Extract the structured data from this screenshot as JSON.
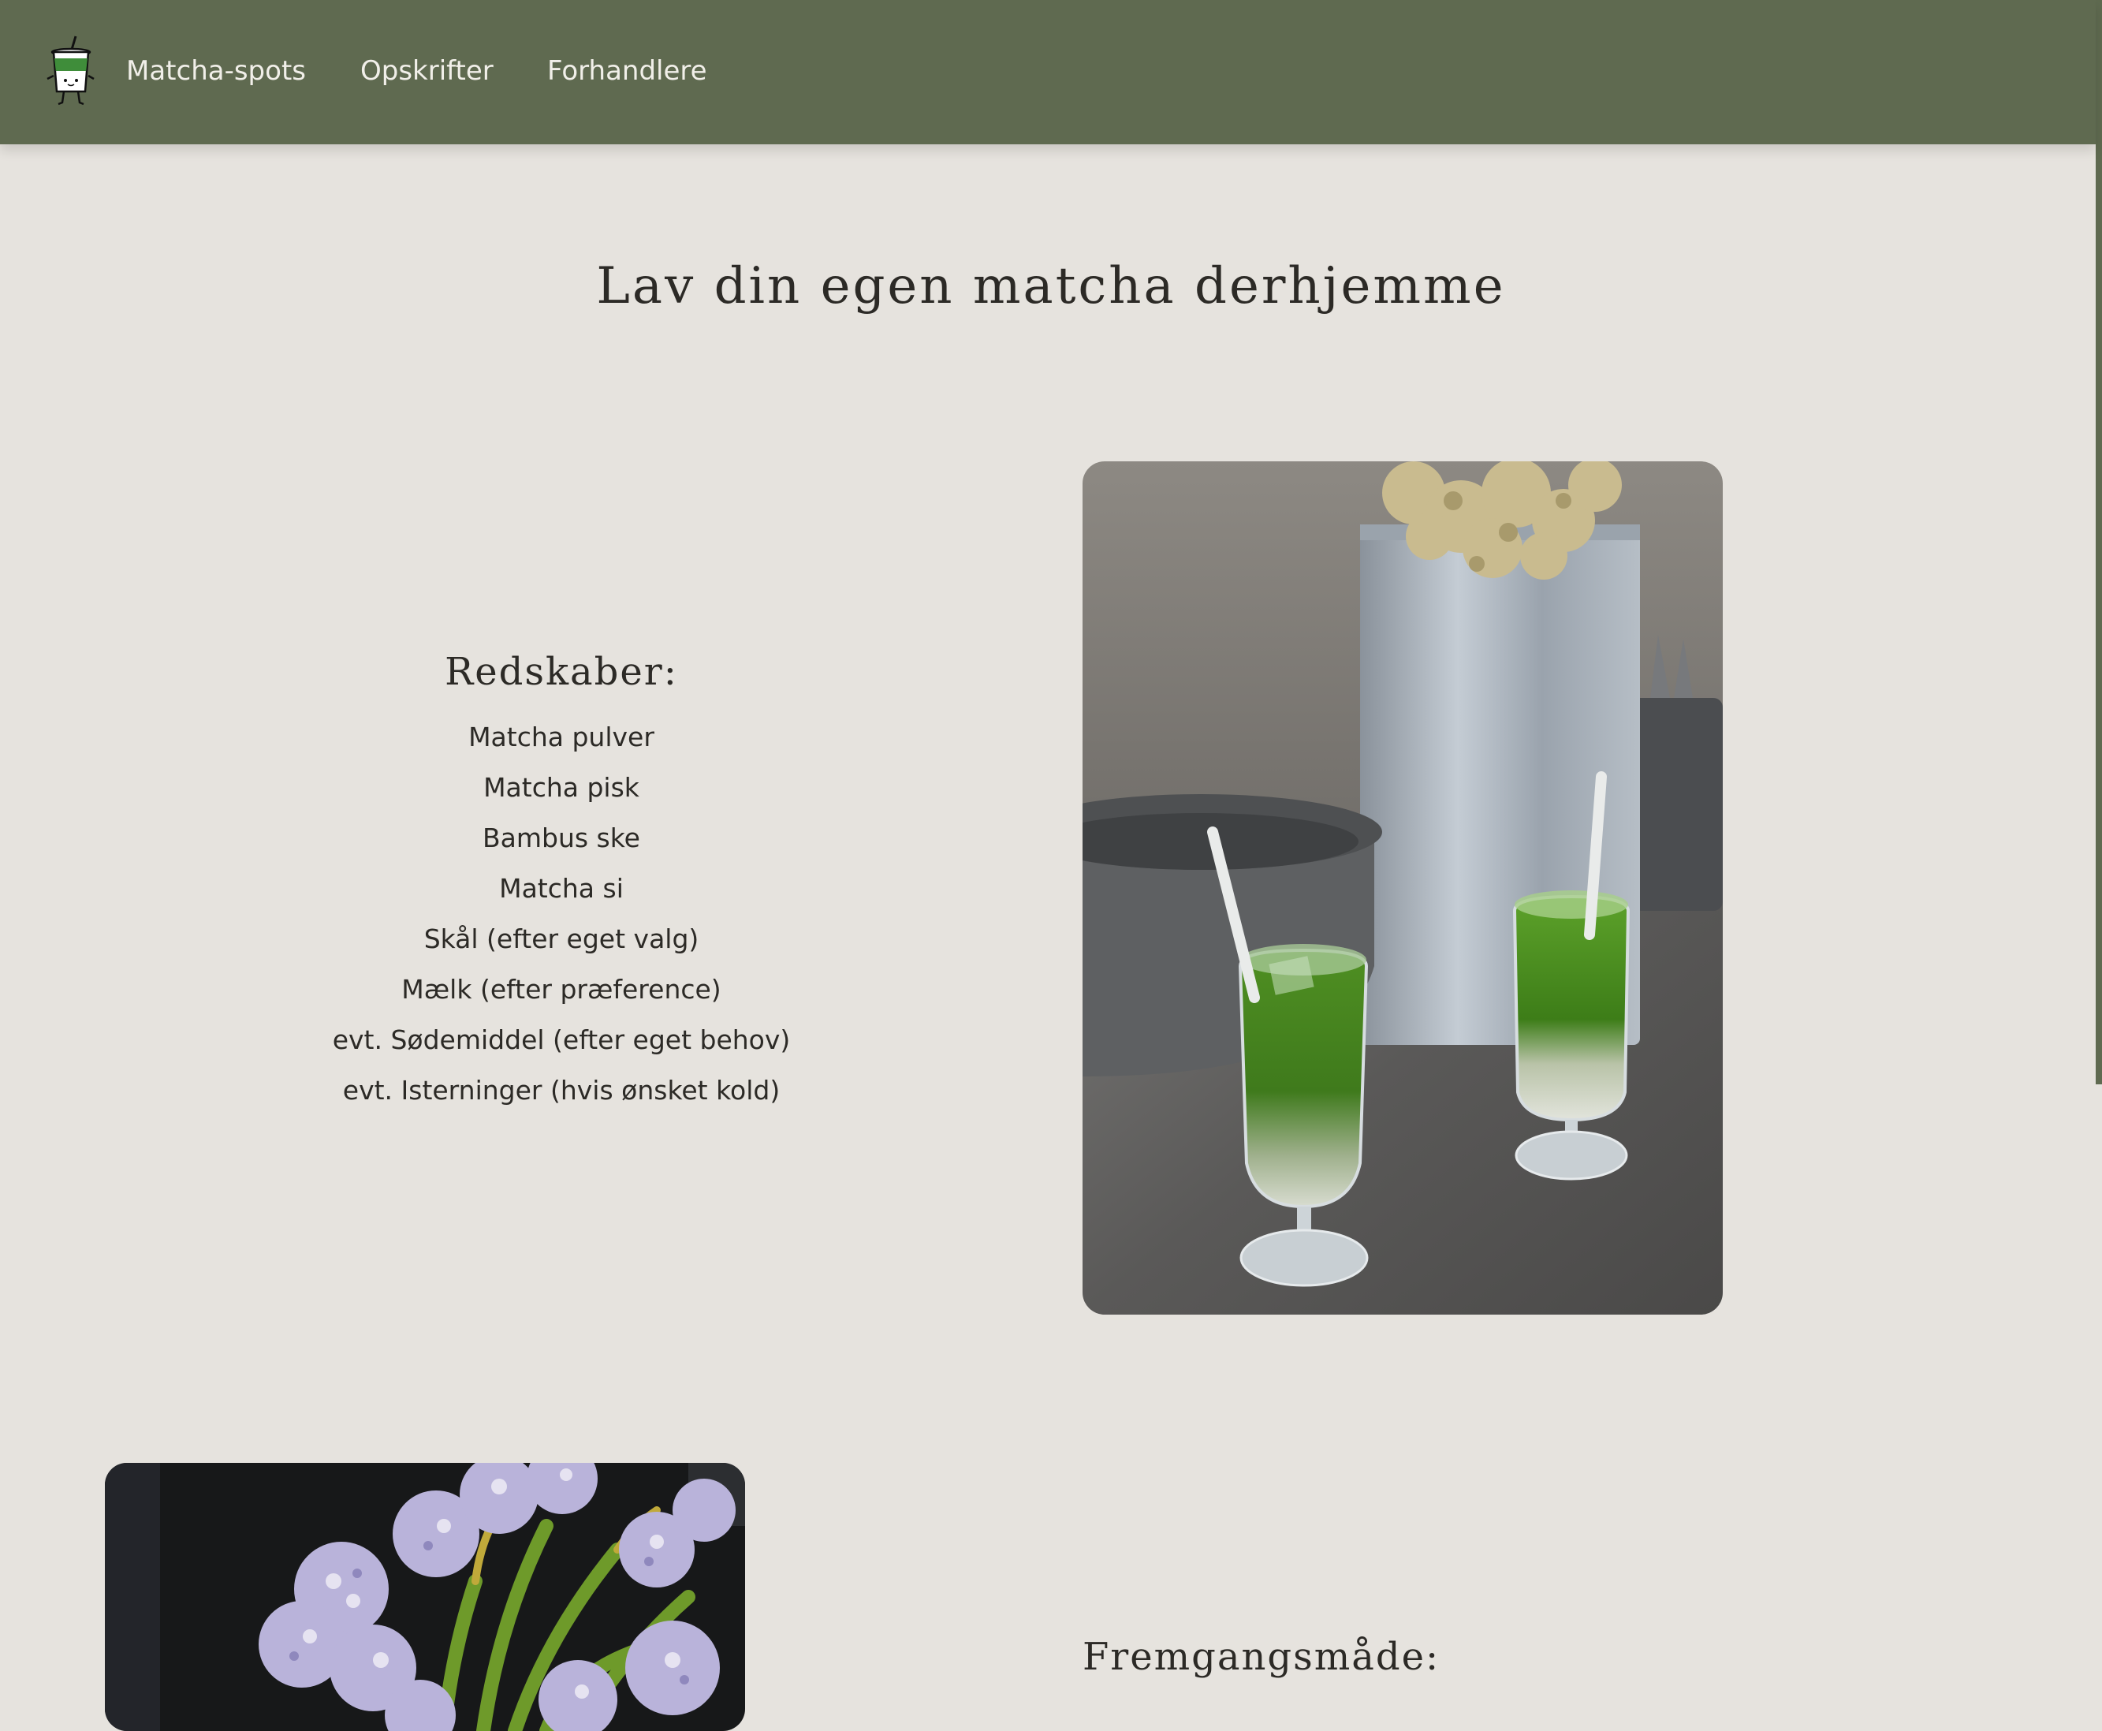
{
  "nav": {
    "logo_icon": "matcha-cup-mascot-icon",
    "links": [
      {
        "label": "Matcha-spots"
      },
      {
        "label": "Opskrifter"
      },
      {
        "label": "Forhandlere"
      }
    ]
  },
  "page": {
    "title": "Lav din egen matcha derhjemme"
  },
  "tools": {
    "heading": "Redskaber:",
    "items": [
      "Matcha pulver",
      "Matcha pisk",
      "Bambus ske",
      "Matcha si",
      "Skål (efter eget valg)",
      "Mælk (efter præference)",
      "evt. Sødemiddel (efter eget behov)",
      "evt. Isterninger (hvis ønsket kold)"
    ]
  },
  "method": {
    "heading": "Fremgangsmåde:"
  },
  "colors": {
    "header_bg": "#5f6a50",
    "page_bg": "#e6e3de",
    "nav_text": "#f1efe9",
    "body_text": "#2c2a26"
  }
}
